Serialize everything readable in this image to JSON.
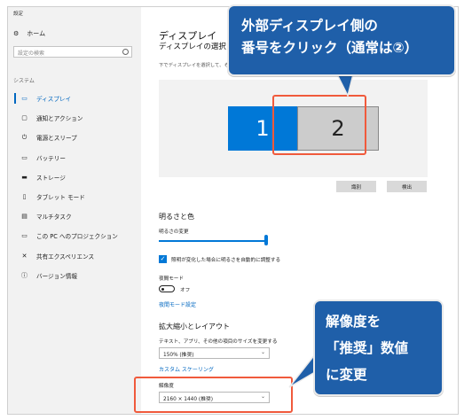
{
  "window": {
    "title": "設定"
  },
  "sidebar": {
    "home_label": "ホーム",
    "search_placeholder": "設定の検索",
    "section_label": "システム",
    "items": [
      {
        "label": "ディスプレイ",
        "icon": "monitor-icon",
        "active": true
      },
      {
        "label": "通知とアクション",
        "icon": "notification-icon"
      },
      {
        "label": "電源とスリープ",
        "icon": "power-icon"
      },
      {
        "label": "バッテリー",
        "icon": "battery-icon"
      },
      {
        "label": "ストレージ",
        "icon": "storage-icon"
      },
      {
        "label": "タブレット モード",
        "icon": "tablet-icon"
      },
      {
        "label": "マルチタスク",
        "icon": "multitask-icon"
      },
      {
        "label": "この PC へのプロジェクション",
        "icon": "projection-icon"
      },
      {
        "label": "共有エクスペリエンス",
        "icon": "shared-icon"
      },
      {
        "label": "バージョン情報",
        "icon": "info-icon"
      }
    ]
  },
  "main": {
    "title": "ディスプレイ",
    "subtitle": "ディスプレイの選択と整理",
    "instruction": "下でディスプレイを選択して、その外",
    "monitors": [
      "1",
      "2"
    ],
    "identify_button": "識別",
    "detect_button": "検出",
    "brightness": {
      "heading": "明るさと色",
      "label": "明るさの変更",
      "level": 1.0,
      "auto_checkbox": "照明が変化した場合に明るさを自動的に調整する",
      "night_mode_label": "夜間モード",
      "night_mode_state": "オフ",
      "night_mode_link": "夜間モード設定"
    },
    "scale": {
      "heading": "拡大縮小とレイアウト",
      "size_label": "テキスト、アプリ、その他の項目のサイズを変更する",
      "size_value": "150% (推奨)",
      "custom_link": "カスタム スケーリング",
      "resolution_label": "解像度",
      "resolution_value": "2160 × 1440 (推奨)"
    }
  },
  "annotations": {
    "callout_top_line1": "外部ディスプレイ側の",
    "callout_top_line2": "番号をクリック（通常は②）",
    "callout_bottom_line1": "解像度を",
    "callout_bottom_line2": "「推奨」数値",
    "callout_bottom_line3": "に変更",
    "highlight_color": "#f05a3c",
    "callout_color": "#1f5fa9"
  }
}
